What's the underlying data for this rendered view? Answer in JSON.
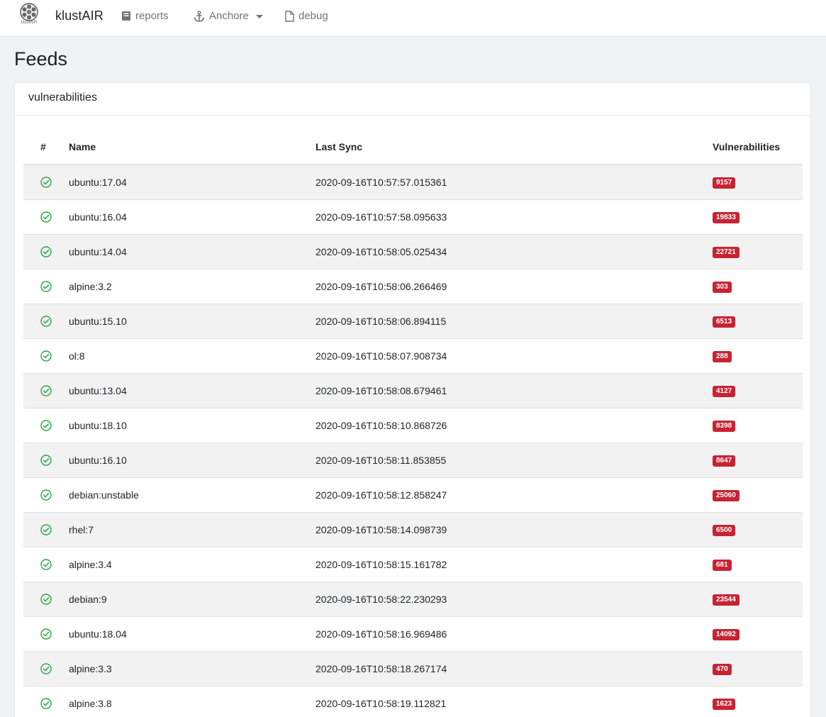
{
  "navbar": {
    "brand_caption": "klustAIR",
    "brand_name": "klustAIR",
    "items": [
      {
        "label": "reports",
        "icon": "book-icon"
      },
      {
        "label": "Anchore",
        "icon": "anchor-icon"
      },
      {
        "label": "debug",
        "icon": "file-icon"
      }
    ]
  },
  "page": {
    "title": "Feeds"
  },
  "card": {
    "title": "vulnerabilities"
  },
  "table": {
    "headers": [
      "#",
      "Name",
      "Last Sync",
      "Vulnerabilities"
    ],
    "status_color": "#28a745",
    "badge_color": "#c82333",
    "rows": [
      {
        "name": "ubuntu:17.04",
        "last_sync": "2020-09-16T10:57:57.015361",
        "count": "9157"
      },
      {
        "name": "ubuntu:16.04",
        "last_sync": "2020-09-16T10:57:58.095633",
        "count": "19833"
      },
      {
        "name": "ubuntu:14.04",
        "last_sync": "2020-09-16T10:58:05.025434",
        "count": "22721"
      },
      {
        "name": "alpine:3.2",
        "last_sync": "2020-09-16T10:58:06.266469",
        "count": "303"
      },
      {
        "name": "ubuntu:15.10",
        "last_sync": "2020-09-16T10:58:06.894115",
        "count": "6513"
      },
      {
        "name": "ol:8",
        "last_sync": "2020-09-16T10:58:07.908734",
        "count": "288"
      },
      {
        "name": "ubuntu:13.04",
        "last_sync": "2020-09-16T10:58:08.679461",
        "count": "4127"
      },
      {
        "name": "ubuntu:18.10",
        "last_sync": "2020-09-16T10:58:10.868726",
        "count": "8398"
      },
      {
        "name": "ubuntu:16.10",
        "last_sync": "2020-09-16T10:58:11.853855",
        "count": "8647"
      },
      {
        "name": "debian:unstable",
        "last_sync": "2020-09-16T10:58:12.858247",
        "count": "25060"
      },
      {
        "name": "rhel:7",
        "last_sync": "2020-09-16T10:58:14.098739",
        "count": "6500"
      },
      {
        "name": "alpine:3.4",
        "last_sync": "2020-09-16T10:58:15.161782",
        "count": "681"
      },
      {
        "name": "debian:9",
        "last_sync": "2020-09-16T10:58:22.230293",
        "count": "23544"
      },
      {
        "name": "ubuntu:18.04",
        "last_sync": "2020-09-16T10:58:16.969486",
        "count": "14092"
      },
      {
        "name": "alpine:3.3",
        "last_sync": "2020-09-16T10:58:18.267174",
        "count": "470"
      },
      {
        "name": "alpine:3.8",
        "last_sync": "2020-09-16T10:58:19.112821",
        "count": "1623"
      }
    ]
  }
}
